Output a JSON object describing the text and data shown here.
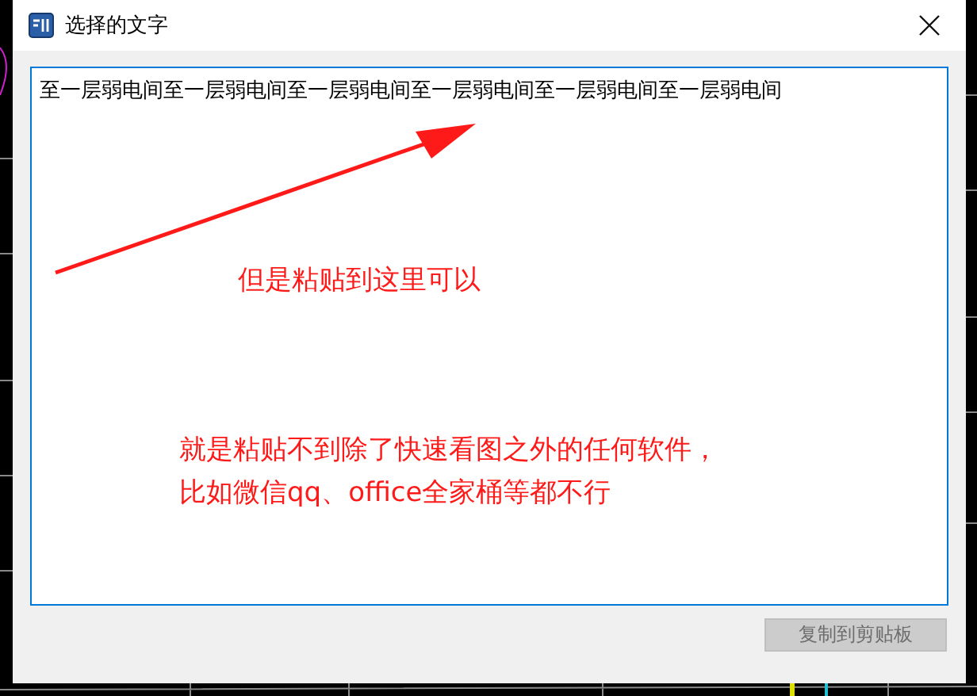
{
  "window": {
    "title": "选择的文字"
  },
  "text_area": {
    "value": "至一层弱电间至一层弱电间至一层弱电间至一层弱电间至一层弱电间至一层弱电间"
  },
  "button": {
    "label": "复制到剪贴板",
    "disabled": true
  },
  "annotations": [
    {
      "kind": "arrow"
    },
    {
      "kind": "note",
      "text": "但是粘贴到这里可以"
    },
    {
      "kind": "note",
      "text": "就是粘贴不到除了快速看图之外的任何软件，"
    },
    {
      "kind": "note",
      "text": "比如微信qq、office全家桶等都不行"
    }
  ]
}
